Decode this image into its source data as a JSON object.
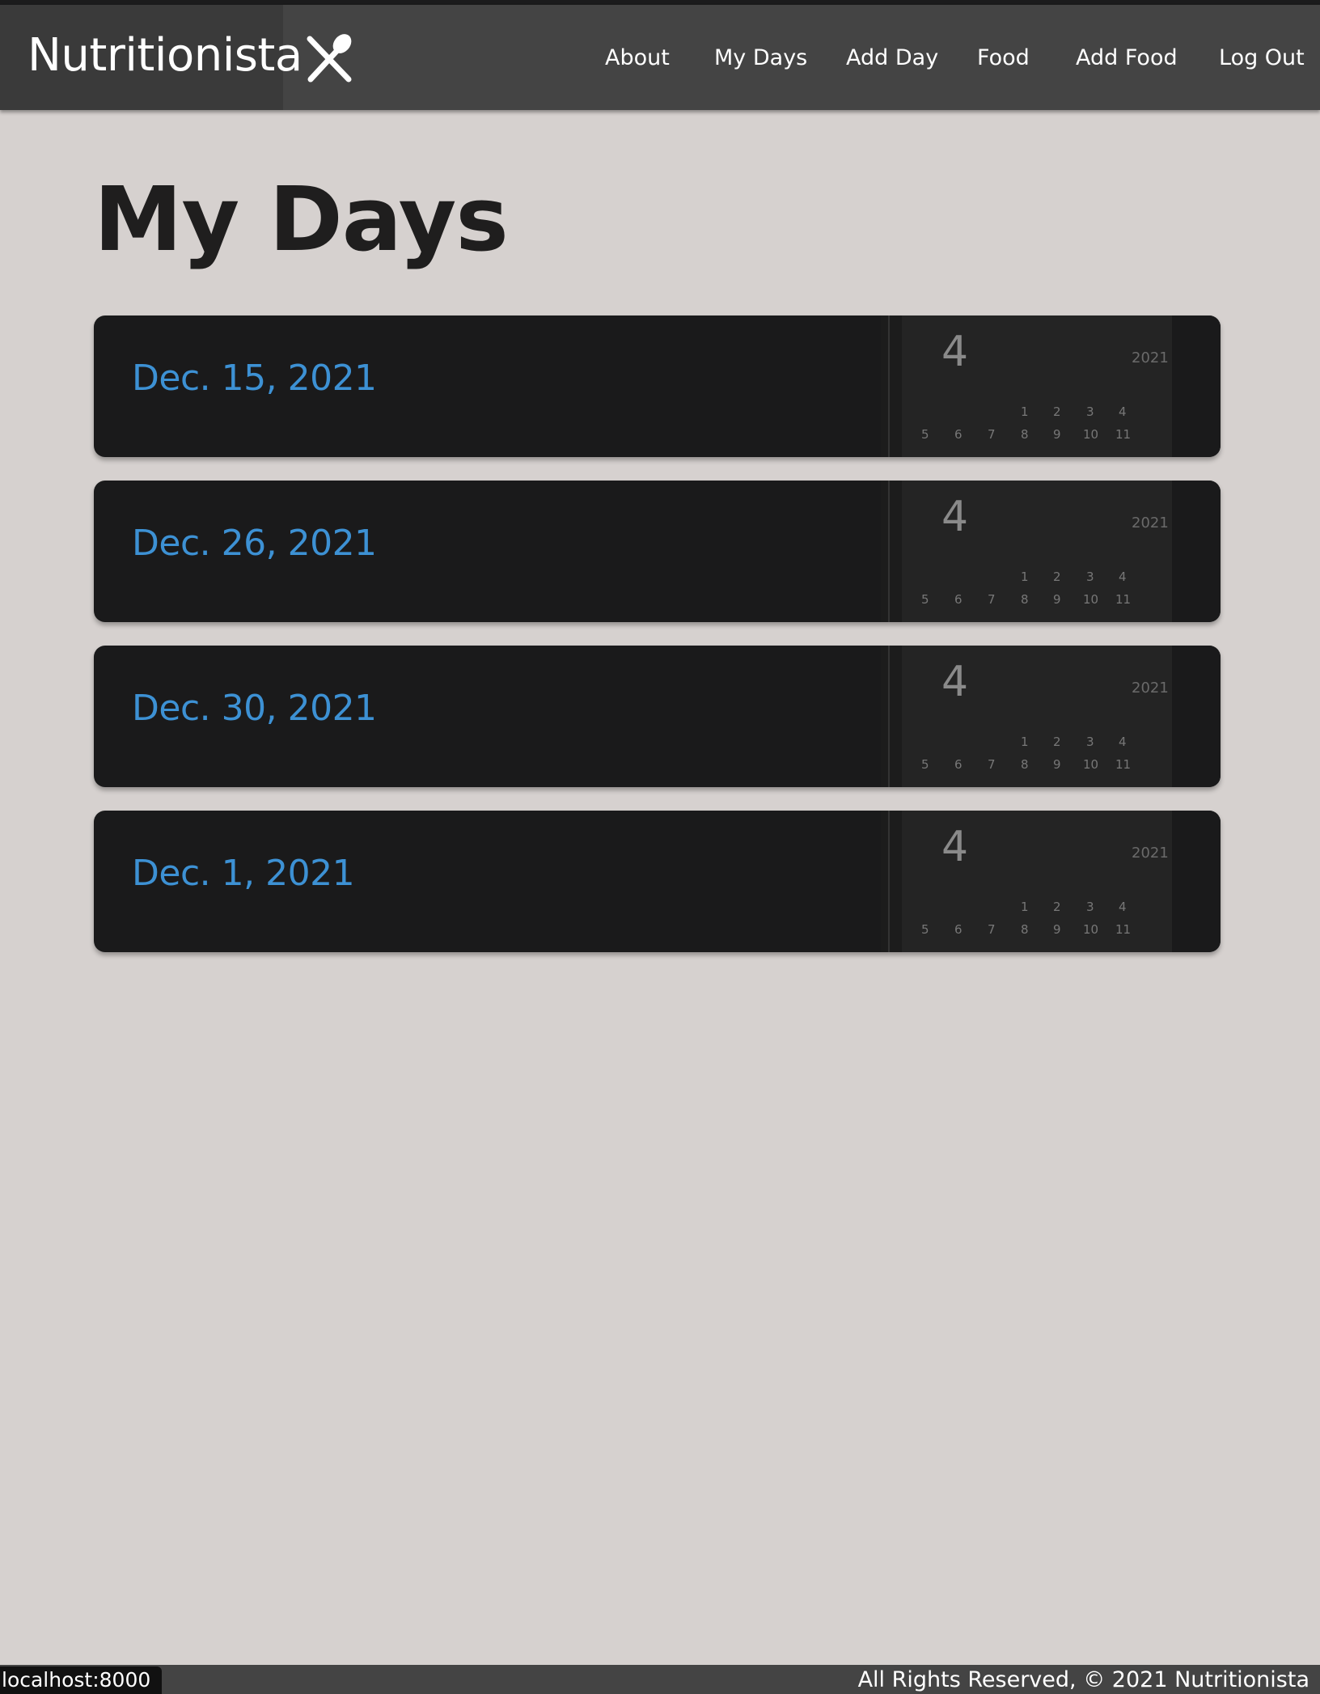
{
  "header": {
    "brand": "Nutritionista",
    "brand_icon": "utensils-icon",
    "nav": [
      {
        "label": "About"
      },
      {
        "label": "My Days"
      },
      {
        "label": "Add Day"
      },
      {
        "label": "Food"
      },
      {
        "label": "Add Food"
      },
      {
        "label": "Log Out"
      }
    ]
  },
  "main": {
    "title": "My Days",
    "days": [
      {
        "date": "Dec. 15, 2021"
      },
      {
        "date": "Dec. 26, 2021"
      },
      {
        "date": "Dec. 30, 2021"
      },
      {
        "date": "Dec. 1, 2021"
      }
    ],
    "card_image": {
      "icon": "calendar-image",
      "big_number": "4",
      "year": "2021",
      "row1": [
        "1",
        "2",
        "3",
        "4"
      ],
      "row2": [
        "5",
        "6",
        "7",
        "8",
        "9",
        "10",
        "11"
      ]
    }
  },
  "footer": {
    "text": "All Rights Reserved, © 2021 Nutritionista"
  },
  "status_bar": {
    "url": "localhost:8000"
  },
  "colors": {
    "page_bg": "#d6d1cf",
    "navbar_bg": "#444444",
    "card_bg": "#1a1a1b",
    "link": "#3d91d4"
  }
}
